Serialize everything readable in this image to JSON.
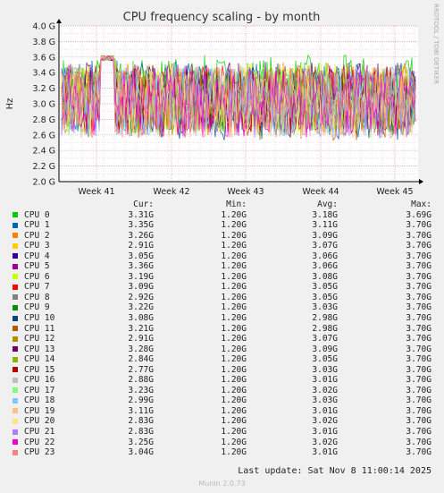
{
  "chart_data": {
    "type": "line",
    "title": "CPU frequency scaling - by month",
    "ylabel": "Hz",
    "y_ticks": [
      "2.0 G",
      "2.2 G",
      "2.4 G",
      "2.6 G",
      "2.8 G",
      "3.0 G",
      "3.2 G",
      "3.4 G",
      "3.6 G",
      "3.8 G",
      "4.0 G"
    ],
    "ylim": [
      2.0,
      4.0
    ],
    "x_ticks": [
      "Week 41",
      "Week 42",
      "Week 43",
      "Week 44",
      "Week 45"
    ],
    "grid": true,
    "legend_placement": "below",
    "side_text": "RRDTOOL / TOBI OETIKER",
    "columns": {
      "cur": "Cur:",
      "min": "Min:",
      "avg": "Avg:",
      "max": "Max:"
    },
    "series": [
      {
        "name": "CPU 0",
        "color": "#00cc00",
        "cur": "3.31G",
        "min": "1.20G",
        "avg": "3.18G",
        "max": "3.69G"
      },
      {
        "name": "CPU 1",
        "color": "#0066b3",
        "cur": "3.35G",
        "min": "1.20G",
        "avg": "3.11G",
        "max": "3.70G"
      },
      {
        "name": "CPU 2",
        "color": "#ff8000",
        "cur": "3.26G",
        "min": "1.20G",
        "avg": "3.09G",
        "max": "3.70G"
      },
      {
        "name": "CPU 3",
        "color": "#ffcc00",
        "cur": "2.91G",
        "min": "1.20G",
        "avg": "3.07G",
        "max": "3.70G"
      },
      {
        "name": "CPU 4",
        "color": "#330099",
        "cur": "3.05G",
        "min": "1.20G",
        "avg": "3.06G",
        "max": "3.70G"
      },
      {
        "name": "CPU 5",
        "color": "#990099",
        "cur": "3.36G",
        "min": "1.20G",
        "avg": "3.06G",
        "max": "3.70G"
      },
      {
        "name": "CPU 6",
        "color": "#ccff00",
        "cur": "3.19G",
        "min": "1.20G",
        "avg": "3.08G",
        "max": "3.70G"
      },
      {
        "name": "CPU 7",
        "color": "#ff0000",
        "cur": "3.09G",
        "min": "1.20G",
        "avg": "3.05G",
        "max": "3.70G"
      },
      {
        "name": "CPU 8",
        "color": "#808080",
        "cur": "2.92G",
        "min": "1.20G",
        "avg": "3.05G",
        "max": "3.70G"
      },
      {
        "name": "CPU 9",
        "color": "#008f00",
        "cur": "3.22G",
        "min": "1.20G",
        "avg": "3.03G",
        "max": "3.70G"
      },
      {
        "name": "CPU 10",
        "color": "#00487d",
        "cur": "3.08G",
        "min": "1.20G",
        "avg": "2.98G",
        "max": "3.70G"
      },
      {
        "name": "CPU 11",
        "color": "#b35a00",
        "cur": "3.21G",
        "min": "1.20G",
        "avg": "2.98G",
        "max": "3.70G"
      },
      {
        "name": "CPU 12",
        "color": "#b38f00",
        "cur": "2.91G",
        "min": "1.20G",
        "avg": "3.07G",
        "max": "3.70G"
      },
      {
        "name": "CPU 13",
        "color": "#6b006b",
        "cur": "3.28G",
        "min": "1.20G",
        "avg": "3.09G",
        "max": "3.70G"
      },
      {
        "name": "CPU 14",
        "color": "#8fb300",
        "cur": "2.84G",
        "min": "1.20G",
        "avg": "3.05G",
        "max": "3.70G"
      },
      {
        "name": "CPU 15",
        "color": "#b30000",
        "cur": "2.77G",
        "min": "1.20G",
        "avg": "3.03G",
        "max": "3.70G"
      },
      {
        "name": "CPU 16",
        "color": "#bebebe",
        "cur": "2.88G",
        "min": "1.20G",
        "avg": "3.01G",
        "max": "3.70G"
      },
      {
        "name": "CPU 17",
        "color": "#80ff80",
        "cur": "3.23G",
        "min": "1.20G",
        "avg": "3.02G",
        "max": "3.70G"
      },
      {
        "name": "CPU 18",
        "color": "#80c9ff",
        "cur": "2.99G",
        "min": "1.20G",
        "avg": "3.03G",
        "max": "3.70G"
      },
      {
        "name": "CPU 19",
        "color": "#ffc080",
        "cur": "3.11G",
        "min": "1.20G",
        "avg": "3.01G",
        "max": "3.70G"
      },
      {
        "name": "CPU 20",
        "color": "#ffe680",
        "cur": "2.83G",
        "min": "1.20G",
        "avg": "3.02G",
        "max": "3.70G"
      },
      {
        "name": "CPU 21",
        "color": "#aa80ff",
        "cur": "2.83G",
        "min": "1.20G",
        "avg": "3.01G",
        "max": "3.70G"
      },
      {
        "name": "CPU 22",
        "color": "#ee00cc",
        "cur": "3.25G",
        "min": "1.20G",
        "avg": "3.02G",
        "max": "3.70G"
      },
      {
        "name": "CPU 23",
        "color": "#ff8080",
        "cur": "3.04G",
        "min": "1.20G",
        "avg": "3.01G",
        "max": "3.70G"
      }
    ]
  },
  "footer": {
    "last_update": "Last update: Sat Nov  8 11:00:14 2025",
    "version": "Munin 2.0.73"
  }
}
